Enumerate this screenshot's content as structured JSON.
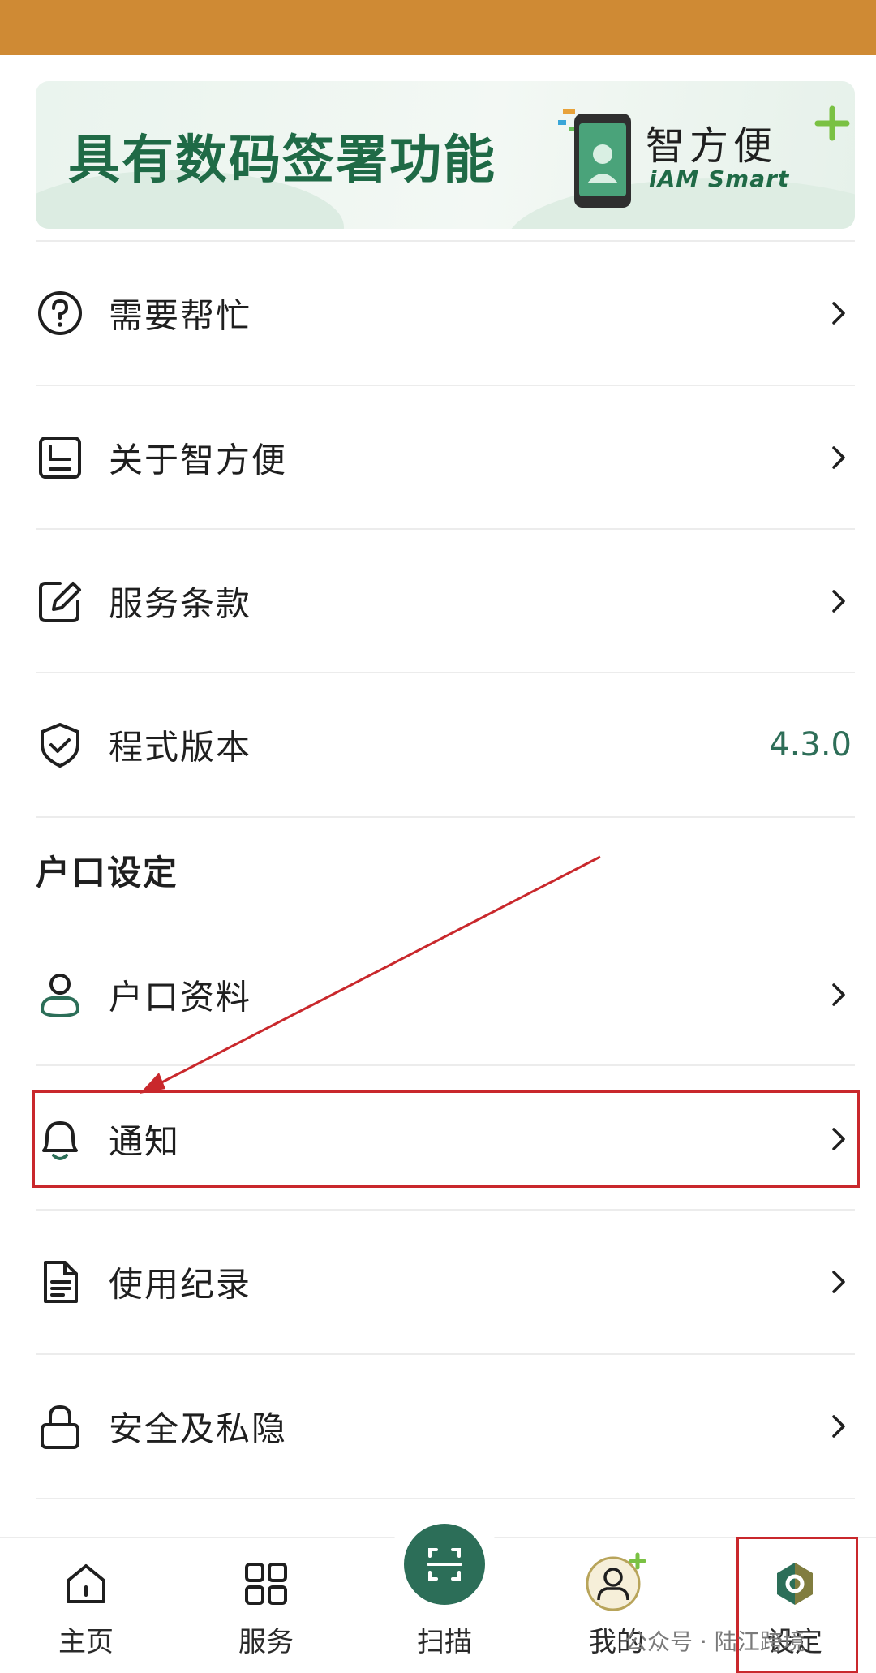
{
  "banner": {
    "title": "具有数码签署功能",
    "brand": "智方便",
    "brand_sub": "iAM Smart"
  },
  "menu": {
    "help": "需要帮忙",
    "about": "关于智方便",
    "terms": "服务条款",
    "version_label": "程式版本",
    "version_value": "4.3.0"
  },
  "account": {
    "section_title": "户口设定",
    "profile": "户口资料",
    "notifications": "通知",
    "usage_log": "使用纪录",
    "security": "安全及私隐"
  },
  "tabbar": {
    "home": "主页",
    "services": "服务",
    "scan": "扫描",
    "mine": "我的",
    "settings": "设定"
  },
  "watermark": "公众号 · 陆江跨境",
  "colors": {
    "status_bar": "#cf8a34",
    "brand_green": "#1f6a46",
    "accent_green": "#2c6e58",
    "highlight_red": "#c9282c"
  }
}
